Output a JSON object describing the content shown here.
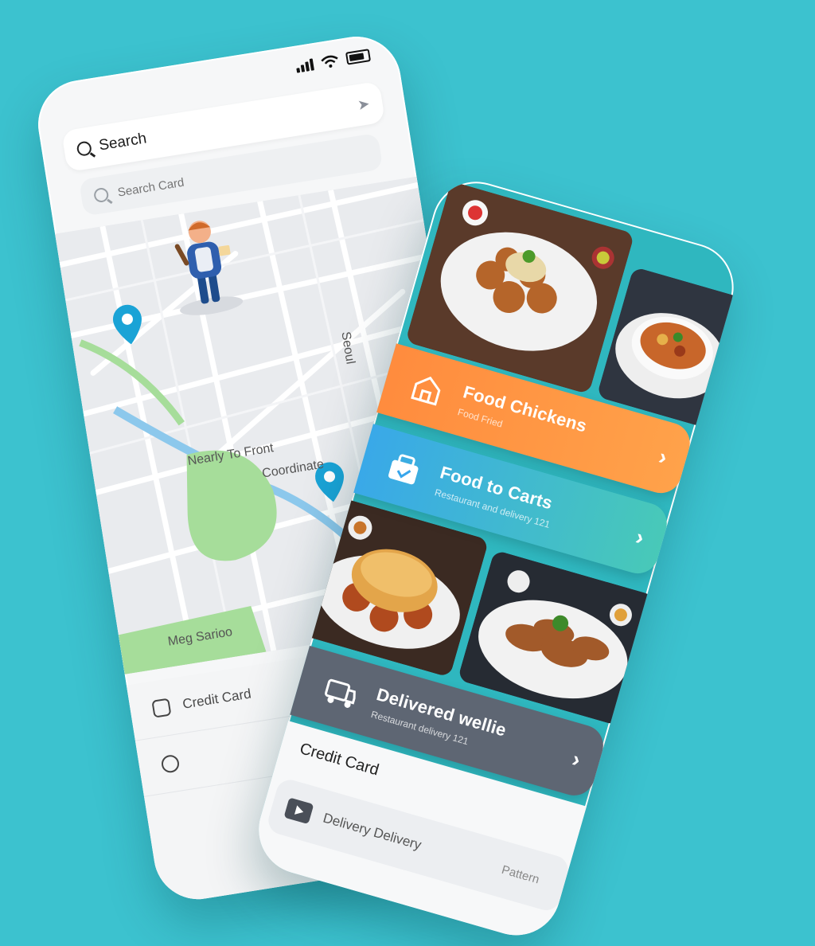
{
  "left": {
    "search_label": "Search",
    "search_card_placeholder": "Search Card",
    "map_labels": [
      "Nearly To Front",
      "Coordinate",
      "Meg Sarioo",
      "Seoul"
    ],
    "bottom_items": [
      {
        "label": "Credit Card"
      },
      {
        "label": ""
      }
    ]
  },
  "right": {
    "cards": [
      {
        "title": "Food Chickens",
        "sub": "Food Fried"
      },
      {
        "title": "Food to Carts",
        "sub": "Restaurant and delivery 121"
      },
      {
        "title": "Delivered wellie",
        "sub": "Restaurant delivery 121"
      }
    ],
    "credit_card_title": "Credit Card",
    "credit_row": {
      "label": "Delivery Delivery",
      "tail": "Pattern"
    }
  },
  "colors": {
    "background": "#3cc2cf",
    "orange": "#ff8a3d",
    "blue": "#38a6ec",
    "teal": "#48c9b8",
    "pin": "#1aa3d6",
    "park": "#a6dd9a",
    "river": "#8cc8ec"
  }
}
